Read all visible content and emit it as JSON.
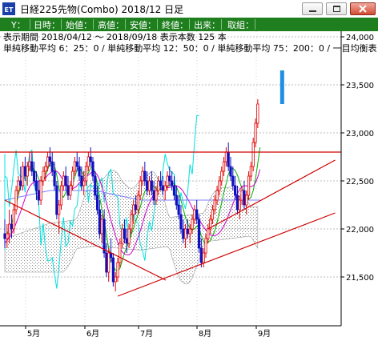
{
  "window": {
    "app_icon_text": "ET",
    "title": "日経225先物(Combo) 2018/12 日足"
  },
  "toolbar": {
    "items": [
      "Y：",
      "日時：",
      "始値：",
      "高値：",
      "安値：",
      "終値：",
      "出来：",
      "取組："
    ]
  },
  "info": {
    "period_line": "表示期間 2018/04/12 ～ 2018/09/18 表示本数 125 本",
    "ma_line": "単純移動平均 6：25：0 / 単純移動平均 12：50：0 / 単純移動平均 75：200：0 / 一目均衡表"
  },
  "colors": {
    "toolbar_bg": "#1f7f1f",
    "up_candle": "#e00000",
    "down_candle": "#1010c0",
    "trendline": "#d00000",
    "ma_short": "#00b000",
    "ma_mid": "#d000d0",
    "ma_long": "#8080ff",
    "cloud_hatch": "#888888",
    "forecast_bar": "#1e90e0",
    "ichimoku_lag": "#00e0e0"
  },
  "chart_data": {
    "type": "candlestick",
    "title": "日経225先物(Combo) 2018/12 日足",
    "x_labels": [
      "5月",
      "6月",
      "7月",
      "8月",
      "9月"
    ],
    "y_ticks": [
      "24,000",
      "23,500",
      "23,000",
      "22,500",
      "22,000",
      "21,500"
    ],
    "ylim": [
      21000,
      24000
    ],
    "horizontal_line": 22800,
    "trendlines": [
      {
        "from": {
          "day": 0,
          "price": 22300
        },
        "to": {
          "day": 50,
          "price": 21300
        }
      },
      {
        "from": {
          "day": 50,
          "price": 21300
        },
        "to": {
          "day": 125,
          "price": 22000
        }
      },
      {
        "from": {
          "day": 90,
          "price": 22000
        },
        "to": {
          "day": 125,
          "price": 22550
        }
      }
    ],
    "candles": [
      [
        21950,
        22100,
        21800,
        21900
      ],
      [
        21900,
        22050,
        21800,
        21950
      ],
      [
        21950,
        22200,
        21850,
        22050
      ],
      [
        22050,
        22150,
        21900,
        22000
      ],
      [
        22000,
        22250,
        21950,
        22200
      ],
      [
        22200,
        22450,
        22150,
        22400
      ],
      [
        22400,
        22550,
        22350,
        22500
      ],
      [
        22500,
        22650,
        22400,
        22450
      ],
      [
        22450,
        22700,
        22400,
        22650
      ],
      [
        22650,
        22750,
        22500,
        22550
      ],
      [
        22550,
        22700,
        22450,
        22650
      ],
      [
        22650,
        22800,
        22600,
        22700
      ],
      [
        22700,
        22800,
        22550,
        22600
      ],
      [
        22600,
        22700,
        22450,
        22500
      ],
      [
        22500,
        22600,
        22300,
        22400
      ],
      [
        22400,
        22500,
        22250,
        22300
      ],
      [
        22300,
        22550,
        22250,
        22500
      ],
      [
        22500,
        22650,
        22450,
        22600
      ],
      [
        22600,
        22700,
        22500,
        22650
      ],
      [
        22650,
        22800,
        22600,
        22750
      ],
      [
        22750,
        22850,
        22650,
        22700
      ],
      [
        22700,
        22800,
        22550,
        22600
      ],
      [
        22600,
        22700,
        22400,
        22450
      ],
      [
        22450,
        22500,
        22100,
        22150
      ],
      [
        22150,
        22300,
        21950,
        22250
      ],
      [
        22250,
        22500,
        22200,
        22450
      ],
      [
        22450,
        22600,
        22400,
        22550
      ],
      [
        22550,
        22650,
        22400,
        22450
      ],
      [
        22450,
        22550,
        22300,
        22350
      ],
      [
        22350,
        22500,
        22300,
        22450
      ],
      [
        22450,
        22650,
        22400,
        22600
      ],
      [
        22600,
        22750,
        22550,
        22700
      ],
      [
        22700,
        22800,
        22600,
        22650
      ],
      [
        22650,
        22750,
        22500,
        22550
      ],
      [
        22550,
        22650,
        22400,
        22450
      ],
      [
        22450,
        22600,
        22350,
        22500
      ],
      [
        22500,
        22700,
        22450,
        22650
      ],
      [
        22650,
        22800,
        22600,
        22750
      ],
      [
        22750,
        22850,
        22650,
        22700
      ],
      [
        22700,
        22750,
        22500,
        22550
      ],
      [
        22550,
        22600,
        22300,
        22350
      ],
      [
        22350,
        22450,
        22150,
        22200
      ],
      [
        22200,
        22300,
        21900,
        21950
      ],
      [
        21950,
        22150,
        21850,
        22100
      ],
      [
        22100,
        22200,
        21700,
        21750
      ],
      [
        21750,
        21850,
        21500,
        21550
      ],
      [
        21550,
        21800,
        21450,
        21750
      ],
      [
        21750,
        21900,
        21650,
        21700
      ],
      [
        21700,
        21750,
        21400,
        21450
      ],
      [
        21450,
        21550,
        21350,
        21500
      ],
      [
        21500,
        21700,
        21450,
        21650
      ],
      [
        21650,
        21900,
        21600,
        21850
      ],
      [
        21850,
        22050,
        21800,
        22000
      ],
      [
        22000,
        22100,
        21850,
        21900
      ],
      [
        21900,
        22000,
        21750,
        21850
      ],
      [
        21850,
        22050,
        21800,
        22000
      ],
      [
        22000,
        22200,
        21950,
        22150
      ],
      [
        22150,
        22300,
        22050,
        22250
      ],
      [
        22250,
        22350,
        22150,
        22200
      ],
      [
        22200,
        22400,
        22150,
        22350
      ],
      [
        22350,
        22550,
        22300,
        22500
      ],
      [
        22500,
        22650,
        22450,
        22600
      ],
      [
        22600,
        22700,
        22450,
        22500
      ],
      [
        22500,
        22600,
        22350,
        22400
      ],
      [
        22400,
        22550,
        22350,
        22500
      ],
      [
        22500,
        22600,
        22350,
        22400
      ],
      [
        22400,
        22500,
        22250,
        22300
      ],
      [
        22300,
        22450,
        22250,
        22400
      ],
      [
        22400,
        22550,
        22350,
        22500
      ],
      [
        22500,
        22600,
        22400,
        22450
      ],
      [
        22450,
        22550,
        22350,
        22400
      ],
      [
        22400,
        22500,
        22300,
        22450
      ],
      [
        22450,
        22600,
        22400,
        22550
      ],
      [
        22550,
        22650,
        22450,
        22500
      ],
      [
        22500,
        22600,
        22400,
        22450
      ],
      [
        22450,
        22550,
        22300,
        22350
      ],
      [
        22350,
        22450,
        22200,
        22250
      ],
      [
        22250,
        22350,
        22100,
        22150
      ],
      [
        22150,
        22250,
        21950,
        22000
      ],
      [
        22000,
        22100,
        21850,
        21900
      ],
      [
        21900,
        22050,
        21800,
        22000
      ],
      [
        22000,
        22100,
        21900,
        21950
      ],
      [
        21950,
        22050,
        21850,
        22000
      ],
      [
        22000,
        22150,
        21950,
        22100
      ],
      [
        22100,
        22250,
        22050,
        22200
      ],
      [
        22200,
        22300,
        22050,
        22100
      ],
      [
        22100,
        22150,
        21750,
        21800
      ],
      [
        21800,
        21900,
        21600,
        21650
      ],
      [
        21650,
        21800,
        21600,
        21750
      ],
      [
        21750,
        21950,
        21700,
        21900
      ],
      [
        21900,
        22050,
        21850,
        22000
      ],
      [
        22000,
        22150,
        21950,
        22100
      ],
      [
        22100,
        22250,
        22050,
        22200
      ],
      [
        22200,
        22350,
        22150,
        22300
      ],
      [
        22300,
        22450,
        22250,
        22400
      ],
      [
        22400,
        22550,
        22350,
        22500
      ],
      [
        22500,
        22650,
        22450,
        22600
      ],
      [
        22600,
        22750,
        22550,
        22700
      ],
      [
        22700,
        22850,
        22650,
        22800
      ],
      [
        22800,
        22900,
        22600,
        22650
      ],
      [
        22650,
        22750,
        22500,
        22550
      ],
      [
        22550,
        22650,
        22400,
        22450
      ],
      [
        22450,
        22550,
        22300,
        22350
      ],
      [
        22350,
        22450,
        22150,
        22200
      ],
      [
        22200,
        22350,
        22100,
        22300
      ],
      [
        22300,
        22450,
        22250,
        22400
      ],
      [
        22400,
        22500,
        22200,
        22250
      ],
      [
        22250,
        22400,
        22150,
        22350
      ],
      [
        22350,
        22600,
        22300,
        22550
      ],
      [
        22550,
        22700,
        22500,
        22650
      ],
      [
        22650,
        22950,
        22600,
        22900
      ],
      [
        22900,
        23150,
        22850,
        23100
      ],
      [
        23100,
        23350,
        23050,
        23300
      ]
    ],
    "series": [
      {
        "name": "単純移動平均 6",
        "values": [
          21900,
          21950,
          22000,
          22050,
          22150,
          22250,
          22350,
          22450,
          22500,
          22550,
          22600,
          22630,
          22640,
          22620,
          22580,
          22520,
          22480,
          22500,
          22550,
          22620,
          22680,
          22690,
          22660,
          22560,
          22420,
          22350,
          22330,
          22380,
          22420,
          22450,
          22480,
          22540,
          22620,
          22640,
          22600,
          22560,
          22550,
          22580,
          22640,
          22650,
          22580,
          22470,
          22330,
          22200,
          22080,
          21930,
          21800,
          21700,
          21620,
          21570,
          21560,
          21590,
          21670,
          21750,
          21810,
          21870,
          21940,
          22010,
          22080,
          22150,
          22230,
          22320,
          22390,
          22430,
          22450,
          22460,
          22440,
          22420,
          22410,
          22410,
          22420,
          22430,
          22440,
          22450,
          22470,
          22470,
          22440,
          22380,
          22300,
          22210,
          22120,
          22050,
          22010,
          21990,
          22000,
          22030,
          22010,
          21930,
          21870,
          21840,
          21860,
          21880,
          21930,
          21980,
          22070,
          22170,
          22270,
          22380,
          22470,
          22570,
          22620,
          22630,
          22610,
          22560,
          22490,
          22420,
          22370,
          22340,
          22310,
          22330,
          22400,
          22520,
          22680,
          22850
        ]
      },
      {
        "name": "単純移動平均 12",
        "values": [
          21850,
          21880,
          21910,
          21950,
          22000,
          22060,
          22120,
          22180,
          22250,
          22320,
          22390,
          22440,
          22470,
          22490,
          22500,
          22500,
          22500,
          22510,
          22530,
          22560,
          22580,
          22600,
          22610,
          22600,
          22580,
          22540,
          22500,
          22470,
          22450,
          22430,
          22420,
          22430,
          22450,
          22480,
          22500,
          22520,
          22540,
          22560,
          22580,
          22600,
          22590,
          22560,
          22510,
          22440,
          22360,
          22270,
          22180,
          22090,
          22010,
          21930,
          21860,
          21800,
          21760,
          21740,
          21730,
          21730,
          21750,
          21790,
          21850,
          21910,
          21980,
          22060,
          22140,
          22210,
          22270,
          22320,
          22360,
          22390,
          22410,
          22420,
          22430,
          22430,
          22430,
          22430,
          22440,
          22450,
          22450,
          22440,
          22420,
          22390,
          22350,
          22310,
          22270,
          22220,
          22180,
          22140,
          22100,
          22060,
          22020,
          21990,
          21960,
          21940,
          21930,
          21930,
          21940,
          21960,
          21990,
          22030,
          22080,
          22140,
          22200,
          22260,
          22320,
          22370,
          22410,
          22440,
          22450,
          22450,
          22440,
          22440,
          22450,
          22480,
          22540,
          22620
        ]
      },
      {
        "name": "単純移動平均 75",
        "values": [
          22300,
          22305,
          22310,
          22315,
          22320,
          22325,
          22330,
          22335,
          22340,
          22345,
          22350,
          22355,
          22360,
          22365,
          22370,
          22375,
          22380,
          22385,
          22390,
          22395,
          22400,
          22400,
          22400,
          22400,
          22400,
          22400,
          22400,
          22400,
          22400,
          22400,
          22400,
          22400,
          22400,
          22400,
          22400,
          22400,
          22400,
          22400,
          22400,
          22400,
          22400,
          22395,
          22390,
          22385,
          22380,
          22375,
          22370,
          22365,
          22360,
          22355,
          22350,
          22345,
          22340,
          22335,
          22330,
          22325,
          22320,
          22315,
          22310,
          22305,
          22300,
          22300,
          22300,
          22300,
          22300,
          22300,
          22300,
          22300,
          22300,
          22300,
          22300,
          22300,
          22300,
          22300,
          22300,
          22300,
          22300,
          22300,
          22300,
          22300,
          22300,
          22300,
          22300,
          22300,
          22300,
          22300,
          22300,
          22300,
          22300,
          22300,
          22300,
          22300,
          22300,
          22300,
          22300,
          22300,
          22300,
          22300,
          22300,
          22300,
          22300,
          22300,
          22300,
          22300,
          22300,
          22300,
          22300,
          22300,
          22300,
          22300,
          22300,
          22300,
          22300,
          22300
        ]
      }
    ]
  }
}
